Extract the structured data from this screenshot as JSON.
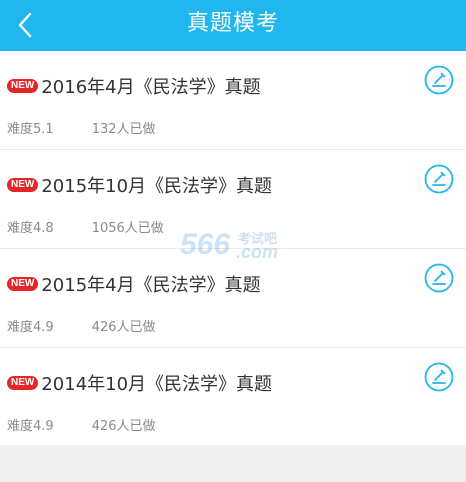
{
  "header": {
    "title": "真题模考",
    "back_icon": "chevron-left-icon",
    "background": "#20b6ee"
  },
  "badge_color": "#e52626",
  "accent": "#20b6ee",
  "exams": [
    {
      "badge": "NEW",
      "title": "2016年4月《民法学》真题",
      "difficulty": "难度5.1",
      "attempts": "132人已做"
    },
    {
      "badge": "NEW",
      "title": "2015年10月《民法学》真题",
      "difficulty": "难度4.8",
      "attempts": "1056人已做"
    },
    {
      "badge": "NEW",
      "title": "2015年4月《民法学》真题",
      "difficulty": "难度4.9",
      "attempts": "426人已做"
    },
    {
      "badge": "NEW",
      "title": "2014年10月《民法学》真题",
      "difficulty": "难度4.9",
      "attempts": "426人已做"
    }
  ],
  "watermark": {
    "number": "566",
    "name": "考试吧",
    "domain": ".com"
  }
}
